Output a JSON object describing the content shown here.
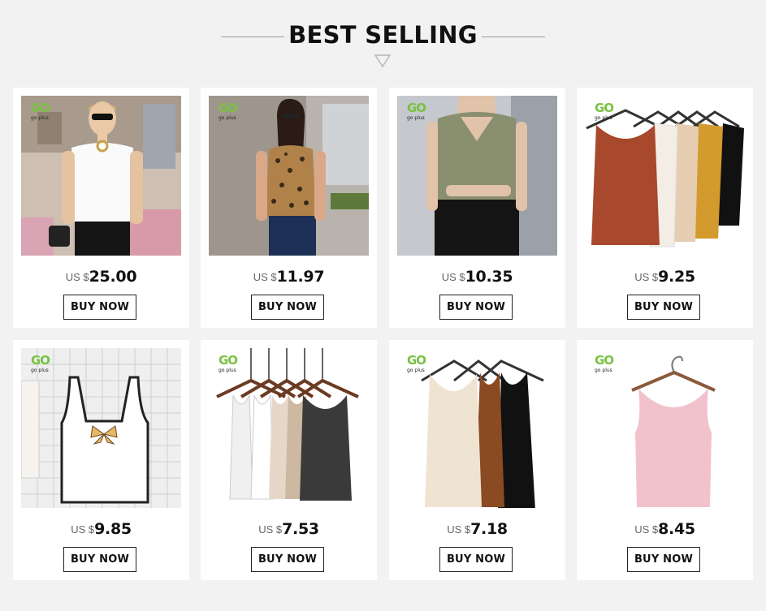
{
  "section": {
    "title": "BEST SELLING"
  },
  "products": [
    {
      "currency": "US $",
      "price": "25.00",
      "button": "BUY NOW",
      "logo_go": "GO",
      "logo_text": "go plus"
    },
    {
      "currency": "US $",
      "price": "11.97",
      "button": "BUY NOW",
      "logo_go": "GO",
      "logo_text": "go plus"
    },
    {
      "currency": "US $",
      "price": "10.35",
      "button": "BUY NOW",
      "logo_go": "GO",
      "logo_text": "go plus"
    },
    {
      "currency": "US $",
      "price": "9.25",
      "button": "BUY NOW",
      "logo_go": "GO",
      "logo_text": "go plus"
    },
    {
      "currency": "US $",
      "price": "9.85",
      "button": "BUY NOW",
      "logo_go": "GO",
      "logo_text": "go plus"
    },
    {
      "currency": "US $",
      "price": "7.53",
      "button": "BUY NOW",
      "logo_go": "GO",
      "logo_text": "go plus"
    },
    {
      "currency": "US $",
      "price": "7.18",
      "button": "BUY NOW",
      "logo_go": "GO",
      "logo_text": "go plus"
    },
    {
      "currency": "US $",
      "price": "8.45",
      "button": "BUY NOW",
      "logo_go": "GO",
      "logo_text": "go plus"
    }
  ],
  "colors": {
    "brand_green": "#7ac142",
    "background": "#f2f2f2"
  }
}
